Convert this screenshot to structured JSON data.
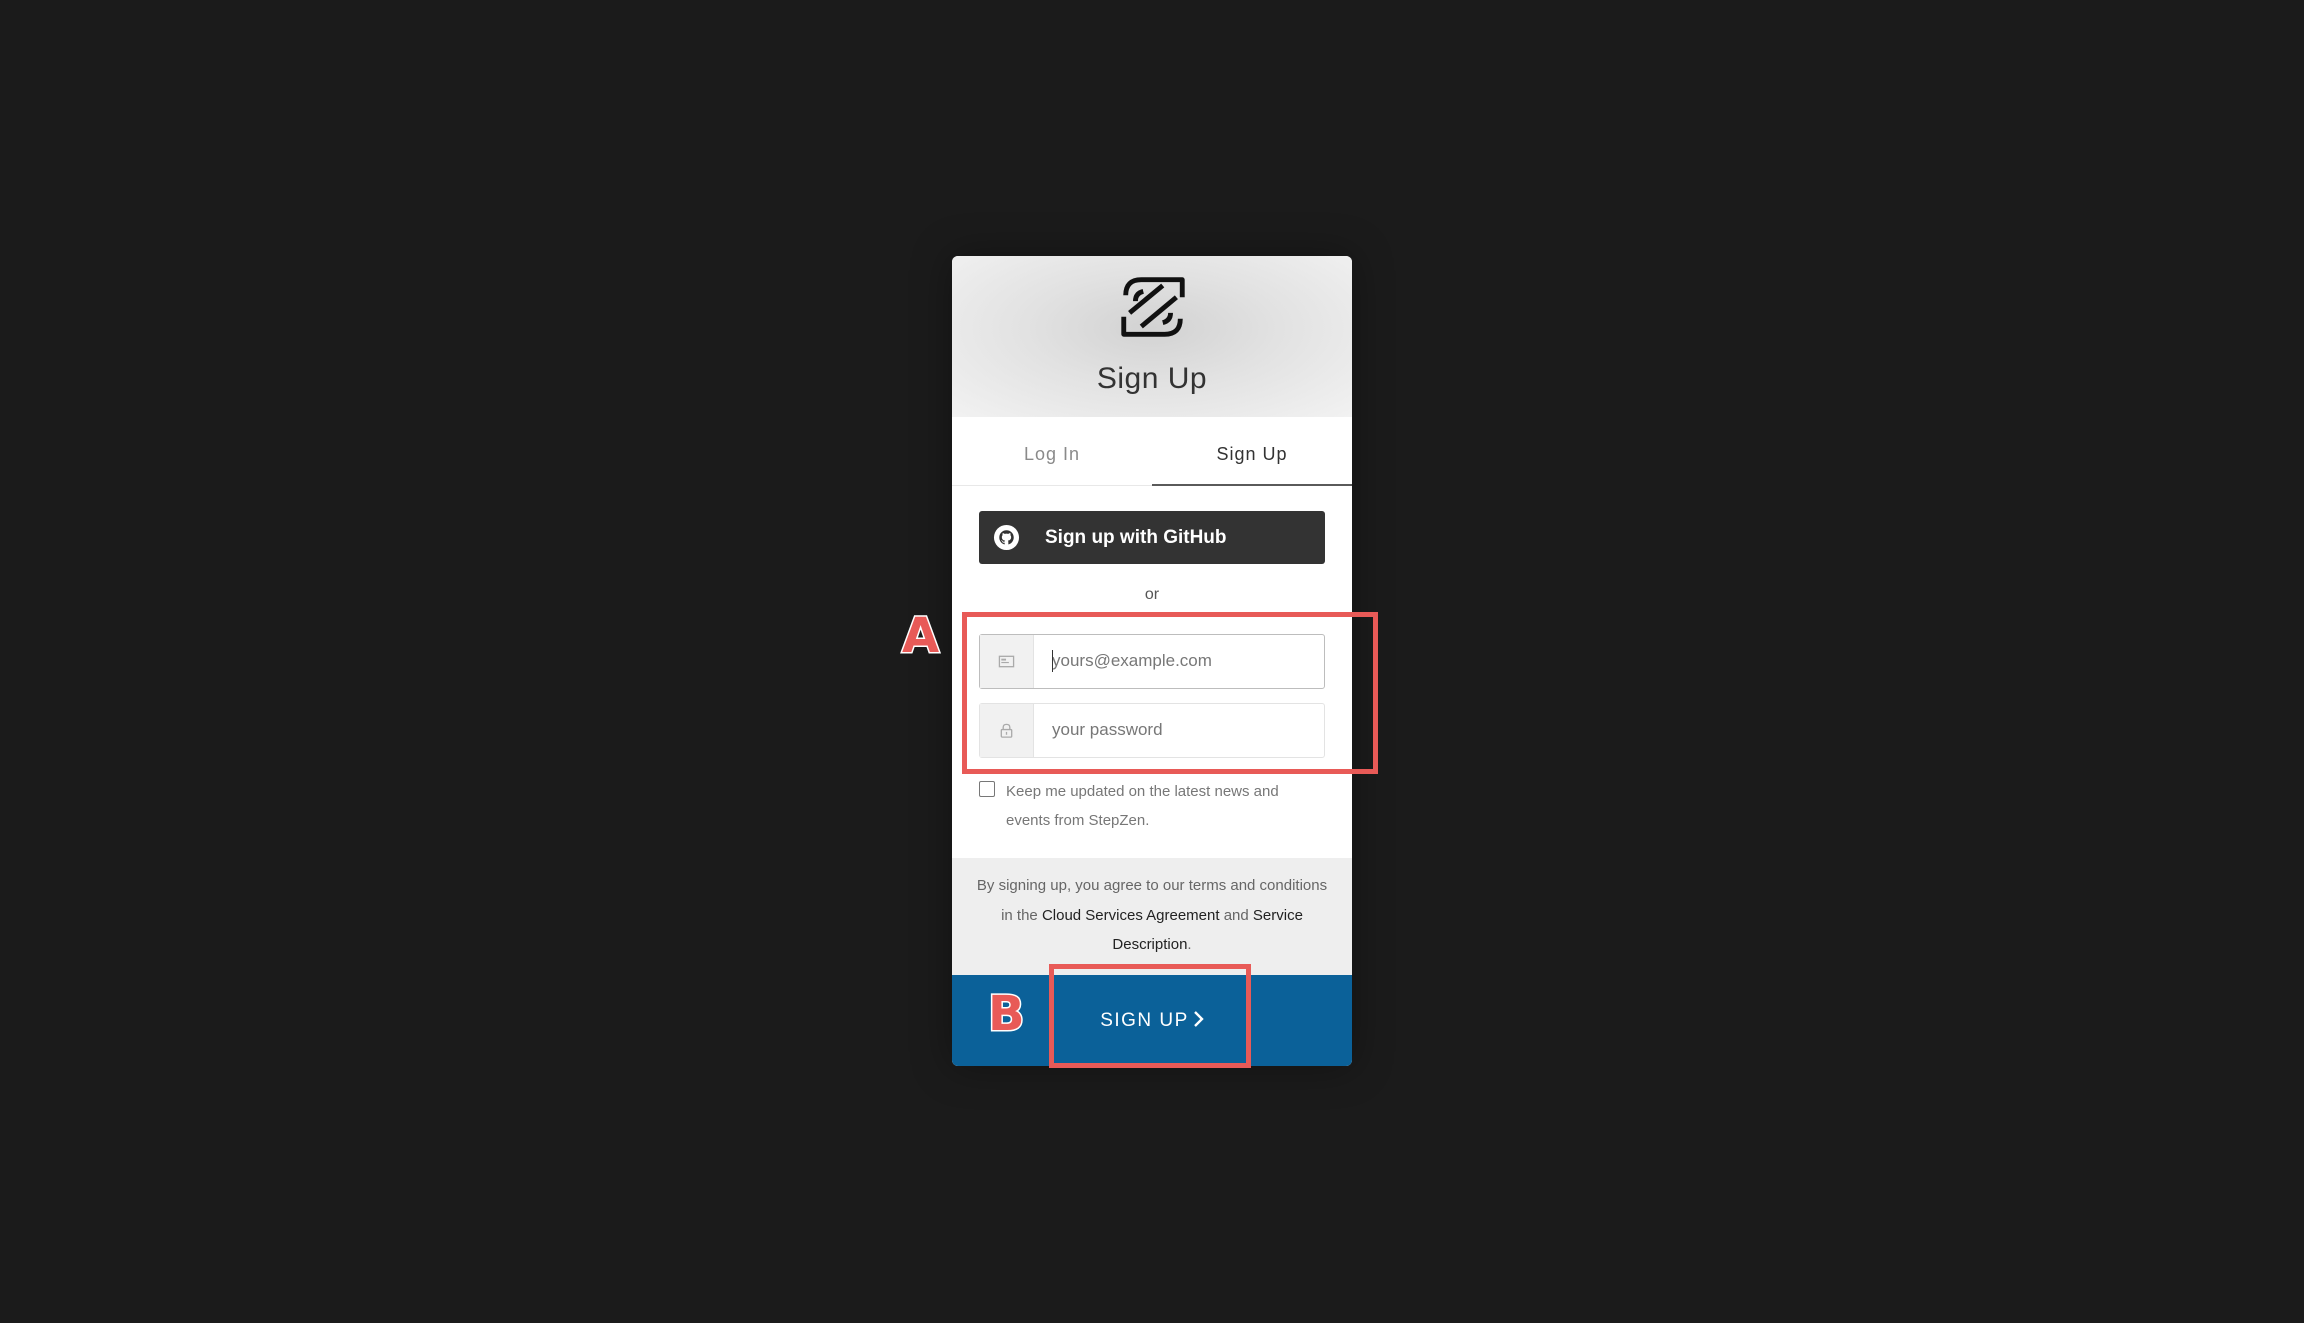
{
  "header": {
    "logo_icon": "stepzen-logo-icon",
    "title": "Sign Up"
  },
  "tabs": [
    {
      "label": "Log In",
      "active": false
    },
    {
      "label": "Sign Up",
      "active": true
    }
  ],
  "github": {
    "icon": "github-icon",
    "label": "Sign up with GitHub"
  },
  "divider": {
    "label": "or"
  },
  "email": {
    "icon": "envelope-icon",
    "placeholder": "yours@example.com",
    "value": ""
  },
  "password": {
    "icon": "lock-icon",
    "placeholder": "your password",
    "value": ""
  },
  "newsletter": {
    "checked": false,
    "label": "Keep me updated on the latest news and events from StepZen."
  },
  "terms": {
    "prefix": "By signing up, you agree to our terms and conditions in the ",
    "link1": "Cloud Services Agreement",
    "middle": " and ",
    "link2": "Service Description",
    "suffix": "."
  },
  "submit": {
    "label": "SIGN UP",
    "icon": "chevron-right-icon"
  },
  "annotations": {
    "a": "A",
    "b": "B"
  },
  "colors": {
    "background": "#1b1b1b",
    "github_button": "#333333",
    "submit_button": "#0b6199",
    "annotation": "#e85a57"
  }
}
